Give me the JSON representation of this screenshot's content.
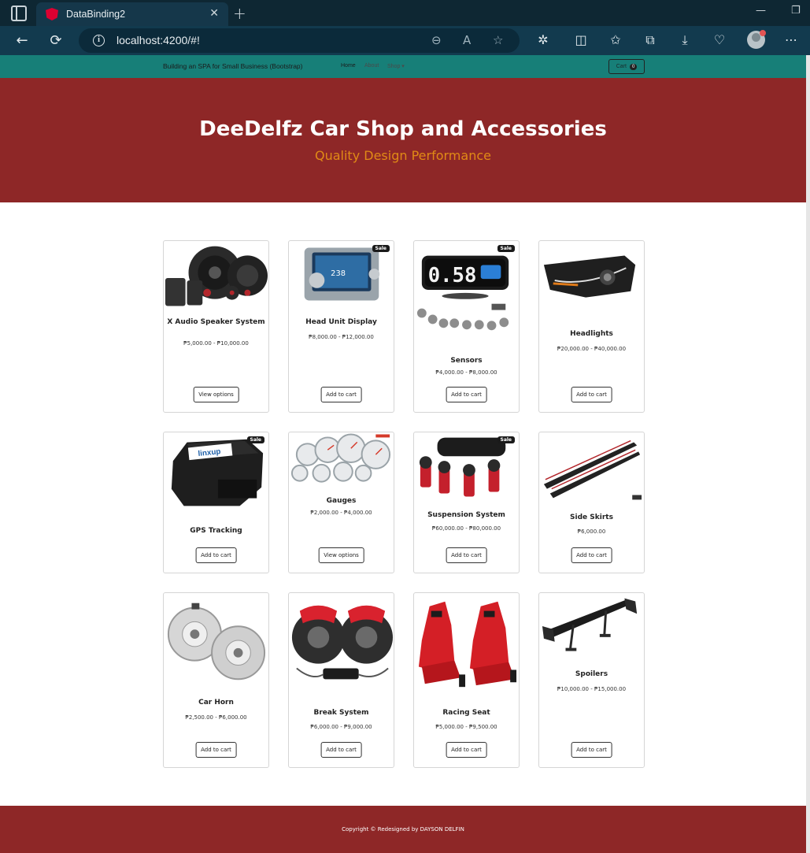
{
  "browser": {
    "tab_title": "DataBinding2",
    "url": "localhost:4200/#!"
  },
  "navbar": {
    "brand": "Building an SPA for Small Business (Bootstrap)",
    "links": [
      "Home",
      "About",
      "Shop ▾"
    ],
    "cart_label": "Cart",
    "cart_count": "0"
  },
  "header": {
    "title": "DeeDelfz Car Shop and Accessories",
    "subtitle": "Quality Design Performance"
  },
  "products": [
    {
      "name": "X Audio Speaker System",
      "price": "₱5,000.00 - ₱10,000.00",
      "button": "View options",
      "badge": ""
    },
    {
      "name": "Head Unit Display",
      "price": "₱8,000.00 - ₱12,000.00",
      "button": "Add to cart",
      "badge": "Sale"
    },
    {
      "name": "Sensors",
      "price": "₱4,000.00 - ₱8,000.00",
      "button": "Add to cart",
      "badge": "Sale"
    },
    {
      "name": "Headlights",
      "price": "₱20,000.00 - ₱40,000.00",
      "button": "Add to cart",
      "badge": ""
    },
    {
      "name": "GPS Tracking",
      "price": "",
      "button": "Add to cart",
      "badge": "Sale"
    },
    {
      "name": "Gauges",
      "price": "₱2,000.00 - ₱4,000.00",
      "button": "View options",
      "badge": ""
    },
    {
      "name": "Suspension System",
      "price": "₱60,000.00 - ₱80,000.00",
      "button": "Add to cart",
      "badge": "Sale"
    },
    {
      "name": "Side Skirts",
      "price": "₱6,000.00",
      "button": "Add to cart",
      "badge": ""
    },
    {
      "name": "Car Horn",
      "price": "₱2,500.00 - ₱6,000.00",
      "button": "Add to cart",
      "badge": ""
    },
    {
      "name": "Break System",
      "price": "₱6,000.00 - ₱9,000.00",
      "button": "Add to cart",
      "badge": ""
    },
    {
      "name": "Racing Seat",
      "price": "₱5,000.00 - ₱9,500.00",
      "button": "Add to cart",
      "badge": ""
    },
    {
      "name": "Spoilers",
      "price": "₱10,000.00 - ₱15,000.00",
      "button": "Add to cart",
      "badge": ""
    }
  ],
  "images": {
    "sensor_display": "0.58",
    "gps_brand": "linxup"
  },
  "footer": {
    "copyright": "Copyright © Redesigned by DAYSON DELFIN"
  }
}
